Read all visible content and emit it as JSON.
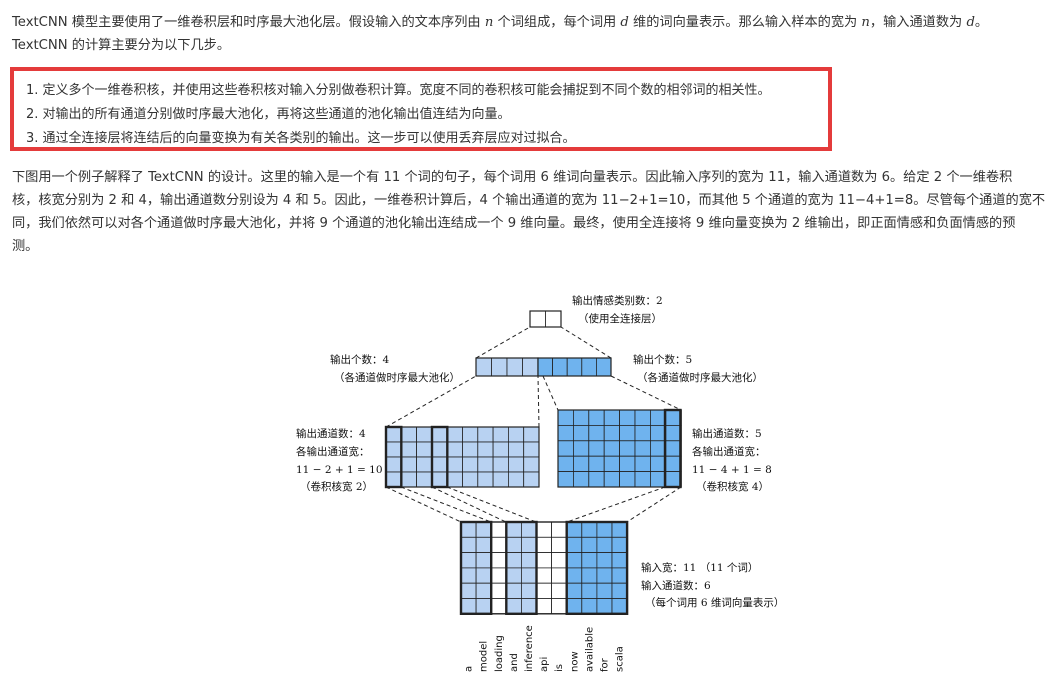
{
  "intro": {
    "line1": "TextCNN 模型主要使用了一维卷积层和时序最大池化层。假设输入的文本序列由 ",
    "var_n": "n",
    "line1b": " 个词组成，每个词用 ",
    "var_d": "d",
    "line1c": " 维的词向量表示。那么输入样本的宽为 ",
    "var_n2": "n",
    "line1d": "，输入通道数为 ",
    "var_d2": "d",
    "line1e": "。",
    "line2": "TextCNN 的计算主要分为以下几步。"
  },
  "steps": [
    "1. 定义多个一维卷积核，并使用这些卷积核对输入分别做卷积计算。宽度不同的卷积核可能会捕捉到不同个数的相邻词的相关性。",
    "2. 对输出的所有通道分别做时序最大池化，再将这些通道的池化输出值连结为向量。",
    "3. 通过全连接层将连结后的向量变换为有关各类别的输出。这一步可以使用丢弃层应对过拟合。"
  ],
  "para2": [
    "下图用一个例子解释了 TextCNN 的设计。这里的输入是一个有 11 个词的句子，每个词用 6 维词向量表示。因此输入序列的宽为 11，输入通道数为 6。给定 2 个一维卷积",
    "核，核宽分别为 2 和 4，输出通道数分别设为 4 和 5。因此，一维卷积计算后，4 个输出通道的宽为 11−2+1=10，而其他 5 个通道的宽为 11−4+1=8。尽管每个通道的宽不",
    "同，我们依然可以对各个通道做时序最大池化，并将 9 个通道的池化输出连结成一个 9 维向量。最终，使用全连接将 9 维向量变换为 2 维输出，即正面情感和负面情感的预",
    "测。"
  ],
  "figure": {
    "top_label1": "输出情感类别数：2",
    "top_label2": "（使用全连接层）",
    "pool_left1": "输出个数：4",
    "pool_left2": "（各通道做时序最大池化）",
    "pool_right1": "输出个数：5",
    "pool_right2": "（各通道做时序最大池化）",
    "conv_left": [
      "输出通道数：4",
      "各输出通道宽：",
      "11 − 2 + 1 = 10",
      "（卷积核宽 2）"
    ],
    "conv_right": [
      "输出通道数：5",
      "各输出通道宽：",
      "11 − 4 + 1 = 8",
      "（卷积核宽 4）"
    ],
    "input_label": [
      "输入宽：11 （11 个词）",
      "输入通道数：6",
      "（每个词用 6 维词向量表示）"
    ],
    "words": [
      "a",
      "model",
      "loading",
      "and",
      "inference",
      "api",
      "is",
      "now",
      "available",
      "for",
      "scala"
    ],
    "colors": {
      "light_blue": "#b8d2f2",
      "mid_blue": "#6fb3ee",
      "line": "#222222",
      "highlight_border": "#e43b3b"
    }
  }
}
